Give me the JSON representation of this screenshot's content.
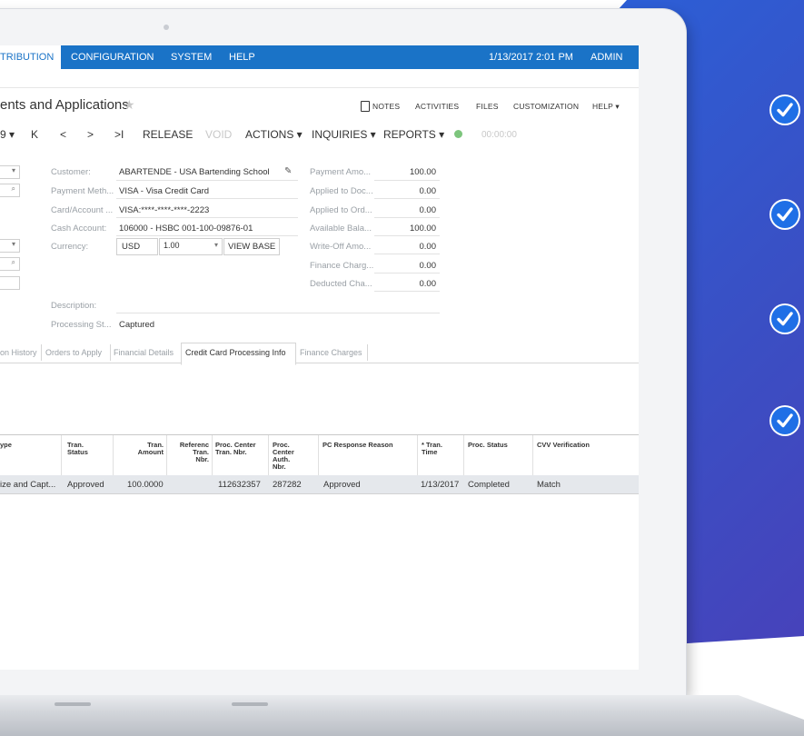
{
  "topnav": {
    "active_item": "TRIBUTION",
    "items": [
      "CONFIGURATION",
      "SYSTEM",
      "HELP"
    ],
    "datetime": "1/13/2017  2:01 PM",
    "user": "ADMIN"
  },
  "page": {
    "title": "ents and Applications",
    "links": [
      "NOTES",
      "ACTIVITIES",
      "FILES",
      "CUSTOMIZATION",
      "HELP ▾"
    ]
  },
  "toolbar": {
    "buttons": [
      "RELEASE",
      "VOID",
      "ACTIONS ▾",
      "INQUIRIES ▾",
      "REPORTS ▾"
    ],
    "timer": "00:00:00"
  },
  "form": {
    "customer_label": "Customer:",
    "customer_value": "ABARTENDE - USA Bartending School",
    "payment_method_label": "Payment Meth...",
    "payment_method_value": "VISA - Visa Credit Card",
    "card_account_label": "Card/Account ...",
    "card_account_value": "VISA:****-****-****-2223",
    "cash_account_label": "Cash Account:",
    "cash_account_value": "106000 - HSBC 001-100-09876-01",
    "currency_label": "Currency:",
    "currency_value": "USD",
    "rate_value": "1.00",
    "view_base": "VIEW BASE",
    "description_label": "Description:",
    "processing_status_label": "Processing St...",
    "processing_status_value": "Captured"
  },
  "amounts": {
    "payment_amount_label": "Payment Amo...",
    "payment_amount": "100.00",
    "applied_to_doc_label": "Applied to Doc...",
    "applied_to_doc": "0.00",
    "applied_to_ord_label": "Applied to Ord...",
    "applied_to_ord": "0.00",
    "available_bal_label": "Available Bala...",
    "available_bal": "100.00",
    "writeoff_label": "Write-Off Amo...",
    "writeoff": "0.00",
    "finance_charge_label": "Finance Charg...",
    "finance_charge": "0.00",
    "deducted_label": "Deducted Cha...",
    "deducted": "0.00"
  },
  "tabs": [
    "on History",
    "Orders to Apply",
    "Financial Details",
    "Credit Card Processing Info",
    "Finance Charges"
  ],
  "grid": {
    "headers": {
      "type": "ype",
      "tran_status": "Tran.\nStatus",
      "tran_amount": "Tran.\nAmount",
      "ref_tran_nbr": "Referenc\nTran.\nNbr.",
      "proc_center_tran": "Proc. Center\nTran. Nbr.",
      "proc_center_auth": "Proc.\nCenter\nAuth.\nNbr.",
      "pc_response": "PC Response Reason",
      "tran_time": "* Tran.\nTime",
      "proc_status": "Proc. Status",
      "cvv": "CVV Verification"
    },
    "row": {
      "type": "ize and Capt...",
      "tran_status": "Approved",
      "tran_amount": "100.0000",
      "ref_tran_nbr": "",
      "proc_center_tran": "112632357",
      "proc_center_auth": "287282",
      "pc_response": "Approved",
      "tran_time": "1/13/2017",
      "proc_status": "Completed",
      "cvv": "Match"
    }
  },
  "colors": {
    "nav_blue": "#1a73c7",
    "bg_blue": "#2c5fd6",
    "check_blue": "#1f6fe6"
  }
}
